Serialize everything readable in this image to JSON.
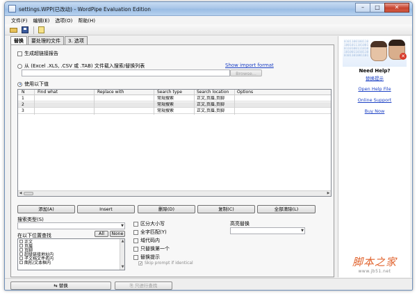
{
  "window": {
    "title": "settings.WPP(已改动) - WordPipe Evaluation Edition",
    "controls": [
      "–",
      "□",
      "✕"
    ]
  },
  "menu": {
    "items": [
      "文件(F)",
      "编辑(E)",
      "选项(O)",
      "帮助(H)"
    ]
  },
  "toolbar": {
    "buttons": [
      "folder-open-icon",
      "save-icon",
      "help-icon"
    ]
  },
  "tabs": [
    {
      "label": "替换",
      "active": true
    },
    {
      "label": "要处理的文件",
      "active": false
    },
    {
      "label": "3. 选项",
      "active": false
    }
  ],
  "options": {
    "generate_report": "生成超链接报告",
    "load_from_file": "从 (Excel .XLS, .CSV 或 .TAB) 文件载入搜索/替换列表",
    "show_import_format": "Show import format",
    "browse": "Browse...",
    "use_following": "使用以下值"
  },
  "grid": {
    "columns": [
      "N",
      "Find what",
      "Replace with",
      "Search type",
      "Search location",
      "Options"
    ],
    "rows": [
      {
        "n": "1",
        "find": "",
        "replace": "",
        "type": "常规搜索",
        "location": "正文,页眉,页脚",
        "options": ""
      },
      {
        "n": "2",
        "find": "",
        "replace": "",
        "type": "常规搜索",
        "location": "正文,页眉,页脚",
        "options": ""
      },
      {
        "n": "3",
        "find": "",
        "replace": "",
        "type": "常规搜索",
        "location": "正文,页眉,页脚",
        "options": ""
      }
    ]
  },
  "grid_buttons": [
    "添加(A)",
    "Insert",
    "删除(D)",
    "复制(C)",
    "全部清除(L)"
  ],
  "search_type": {
    "label": "搜索类型(S)",
    "value": ""
  },
  "locations": {
    "label": "在以下位置查找",
    "all_button": "All",
    "none_button": "None",
    "items": [
      "正文",
      "页眉",
      "页脚",
      "超级链接地址内",
      "子文档文件名内",
      "图形/文本框内"
    ]
  },
  "flags": {
    "match_case": "区分大小写",
    "whole_word": "全字匹配(Y)",
    "in_field_codes": "域代码内",
    "replace_first": "只替换第一个",
    "replace_prompt": "替换提示",
    "skip_identical": "Skip prompt if identical"
  },
  "advanced": {
    "label": "高亮替换",
    "value": ""
  },
  "side": {
    "binary": "0101100100110\n1001011101001\n0110100111010\n1010011010110\n0101101001101",
    "need_help": "Need Help?",
    "replace_tips": "替换提示",
    "open_help": "Open Help File",
    "online_support": "Online Support",
    "buy_now": "Buy Now"
  },
  "bottom": {
    "replace_button": "替换",
    "search_only_button": "只进行查找"
  },
  "watermark": {
    "big": "脚本之家",
    "small": "www.jb51.net"
  }
}
